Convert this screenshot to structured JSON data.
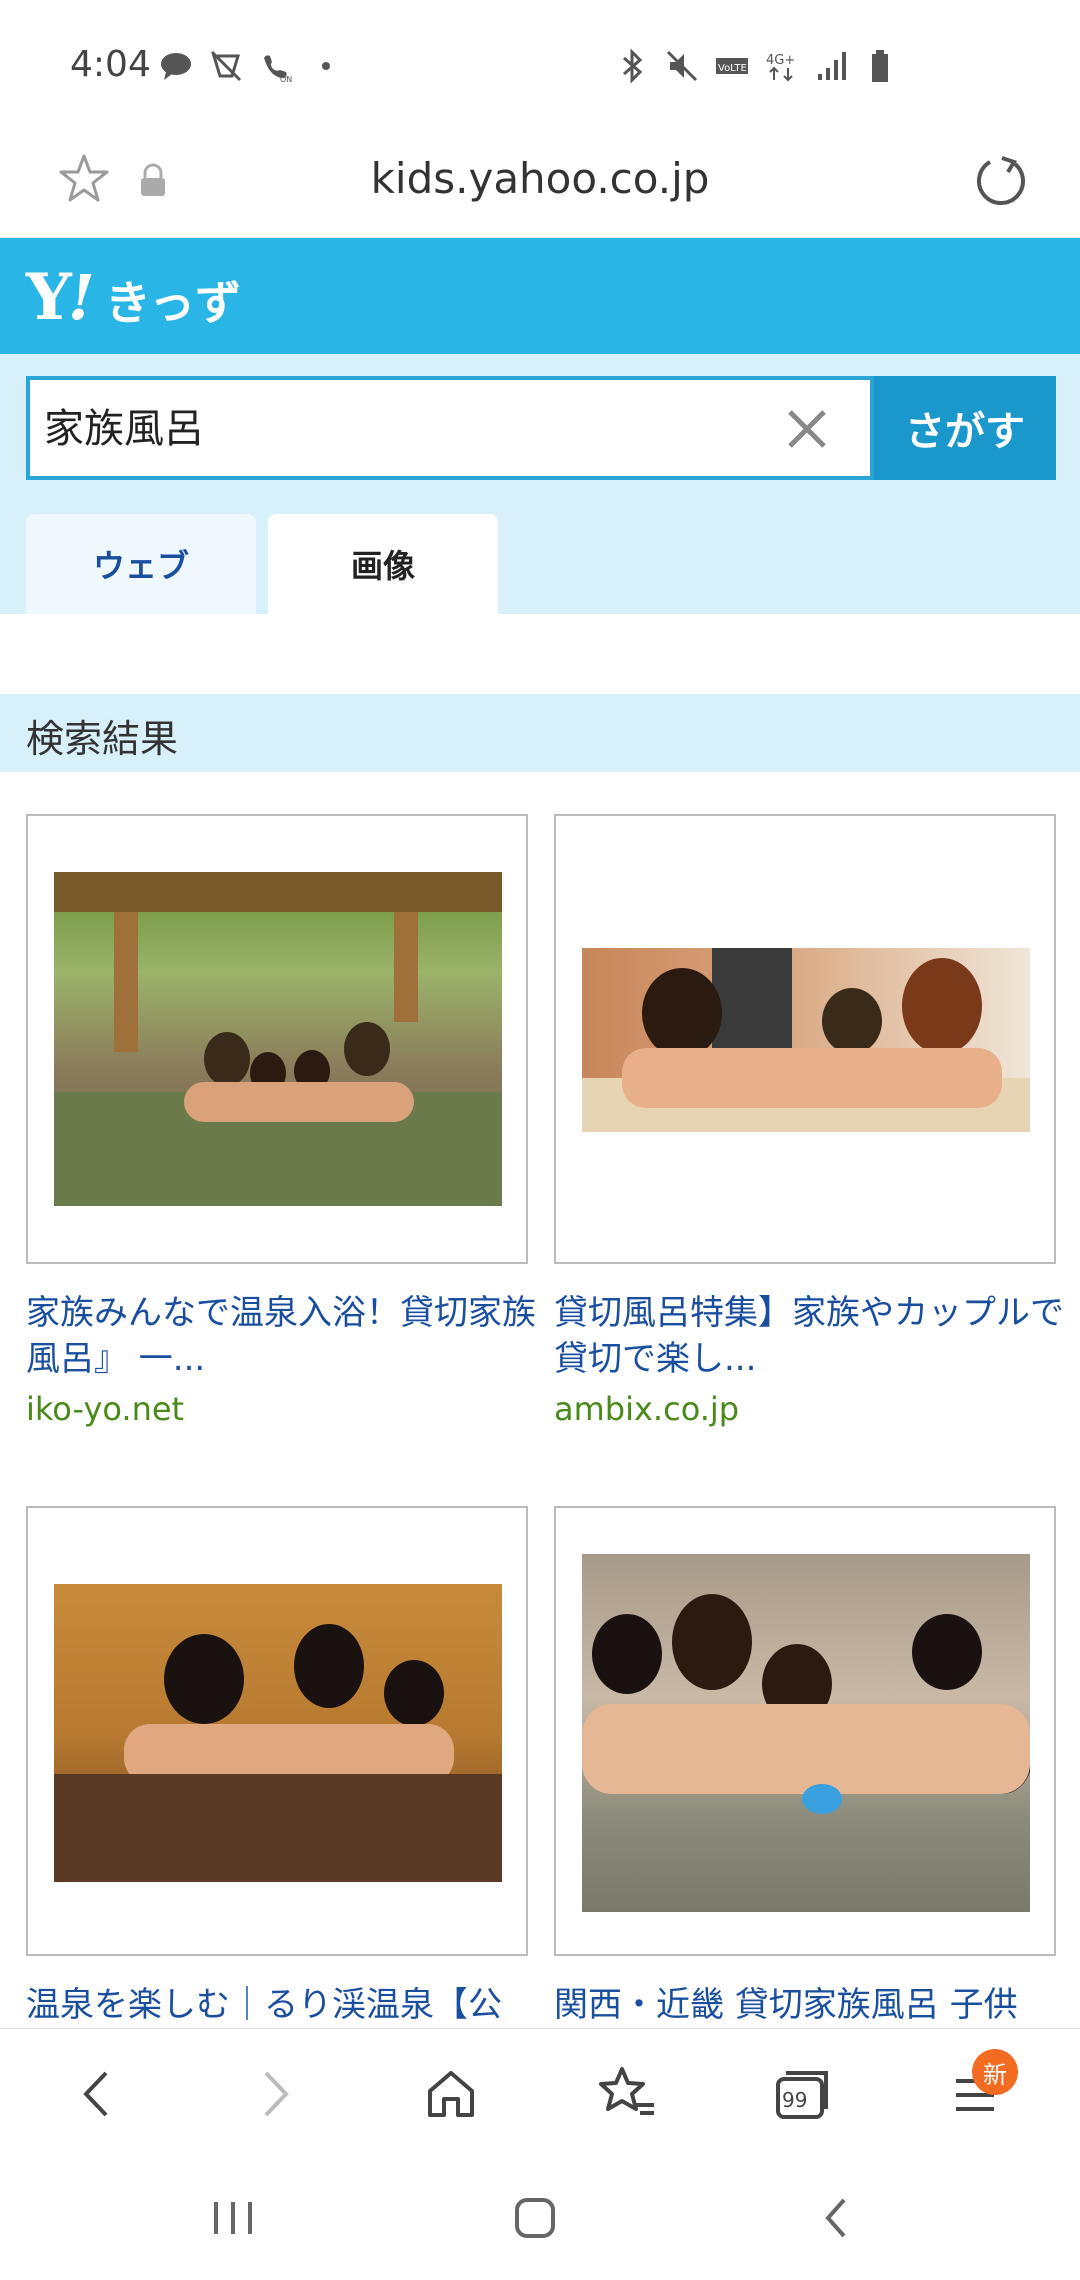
{
  "status_bar": {
    "time": "4:04",
    "left_icons": [
      "chat-bubble-icon",
      "silent-icon",
      "wifi-call-icon",
      "dot-icon"
    ],
    "right_icons": [
      "bluetooth-icon",
      "mute-icon",
      "volte-icon",
      "4g-icon",
      "signal-icon",
      "battery-icon"
    ]
  },
  "browser": {
    "url": "kids.yahoo.co.jp"
  },
  "header": {
    "logo_y": "Y",
    "logo_ex": "!",
    "logo_text": "きっず"
  },
  "search": {
    "value": "家族風呂",
    "button_label": "さがす",
    "tabs": [
      {
        "label": "ウェブ",
        "active": false
      },
      {
        "label": "画像",
        "active": true
      }
    ]
  },
  "results": {
    "header": "検索結果",
    "items": [
      {
        "title": "家族みんなで温泉入浴！貸切家族風呂』 一...",
        "domain": "iko-yo.net"
      },
      {
        "title": "貸切風呂特集】家族やカップルで貸切で楽し...",
        "domain": "ambix.co.jp"
      },
      {
        "title": "温泉を楽しむ｜るり渓温泉【公",
        "domain": ""
      },
      {
        "title": "関西・近畿 貸切家族風呂 子供",
        "domain": ""
      }
    ]
  },
  "bottom_toolbar": {
    "badge": "新",
    "tabs_count": "99"
  },
  "colors": {
    "header_blue": "#29b6e6",
    "search_button": "#1a98cc",
    "link_blue": "#1a4fa0",
    "domain_green": "#4a8a1a",
    "light_blue_bg": "#d8f0fa"
  }
}
